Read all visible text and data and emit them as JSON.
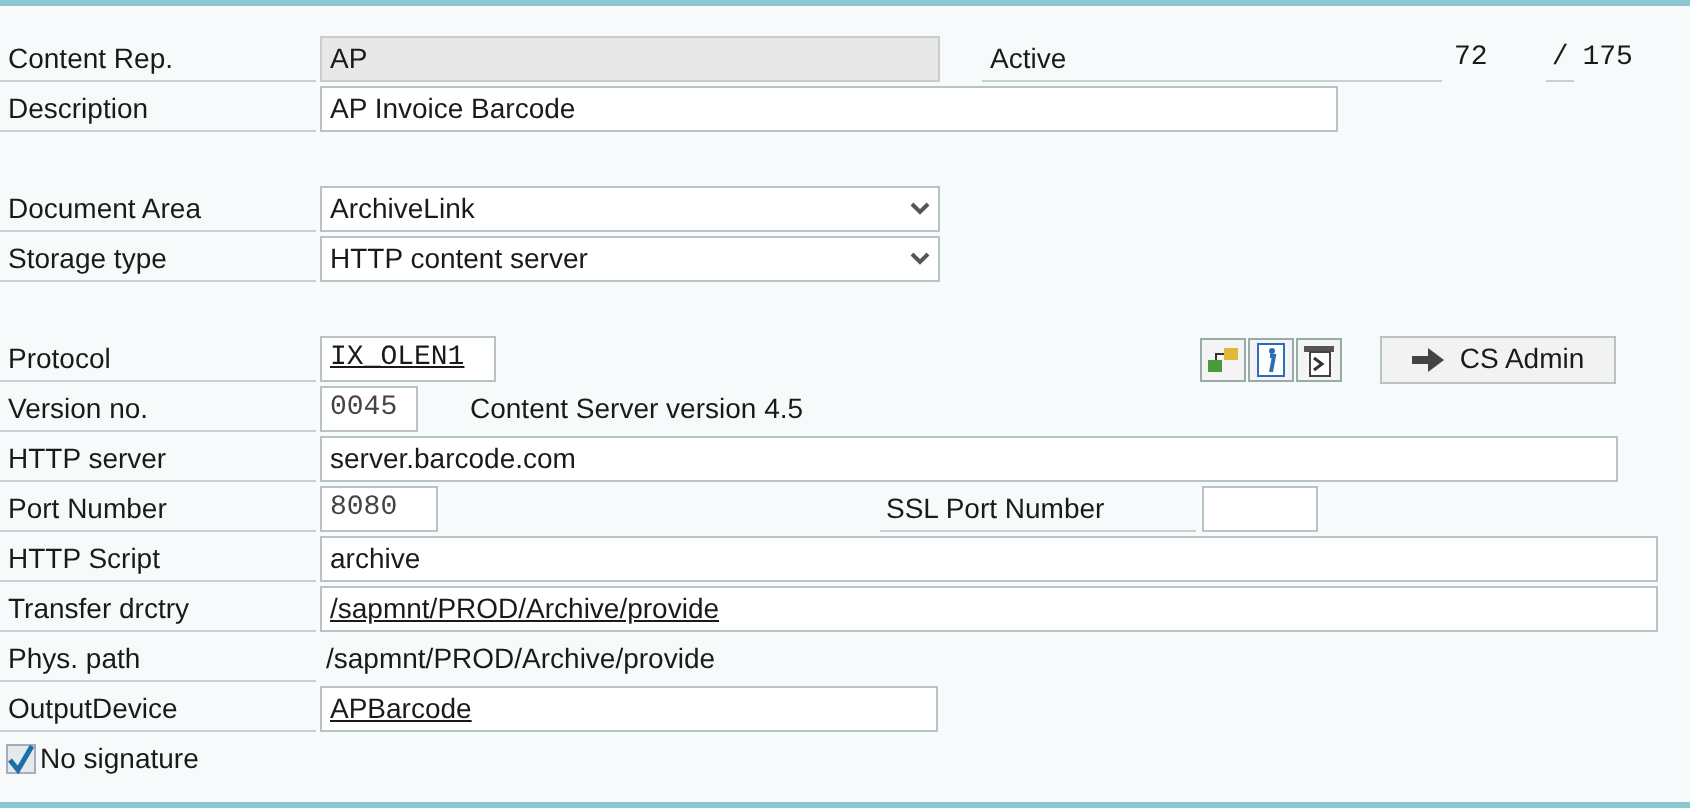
{
  "content_rep": {
    "label": "Content Rep.",
    "value": "AP"
  },
  "status": {
    "label": "Active",
    "current": "72",
    "separator": "/",
    "total": "175"
  },
  "description": {
    "label": "Description",
    "value": "AP Invoice Barcode"
  },
  "document_area": {
    "label": "Document Area",
    "value": "ArchiveLink"
  },
  "storage_type": {
    "label": "Storage type",
    "value": "HTTP content server"
  },
  "protocol": {
    "label": "Protocol",
    "value": "IX_OLEN1"
  },
  "cs_admin_button": {
    "label": "CS Admin"
  },
  "version": {
    "label": "Version no.",
    "value": "0045",
    "note": "Content Server version 4.5"
  },
  "http_server": {
    "label": "HTTP server",
    "value": "server.barcode.com"
  },
  "port": {
    "label": "Port Number",
    "value": "8080"
  },
  "ssl_port": {
    "label": "SSL Port Number"
  },
  "http_script": {
    "label": "HTTP Script",
    "value": "archive"
  },
  "transfer_directory": {
    "label": "Transfer drctry",
    "value": "/sapmnt/PROD/Archive/provide"
  },
  "physical_path": {
    "label": "Phys. path",
    "value": "/sapmnt/PROD/Archive/provide"
  },
  "output_device": {
    "label": "OutputDevice",
    "value": "APBarcode"
  },
  "no_signature": {
    "label": "No signature",
    "checked": true
  }
}
